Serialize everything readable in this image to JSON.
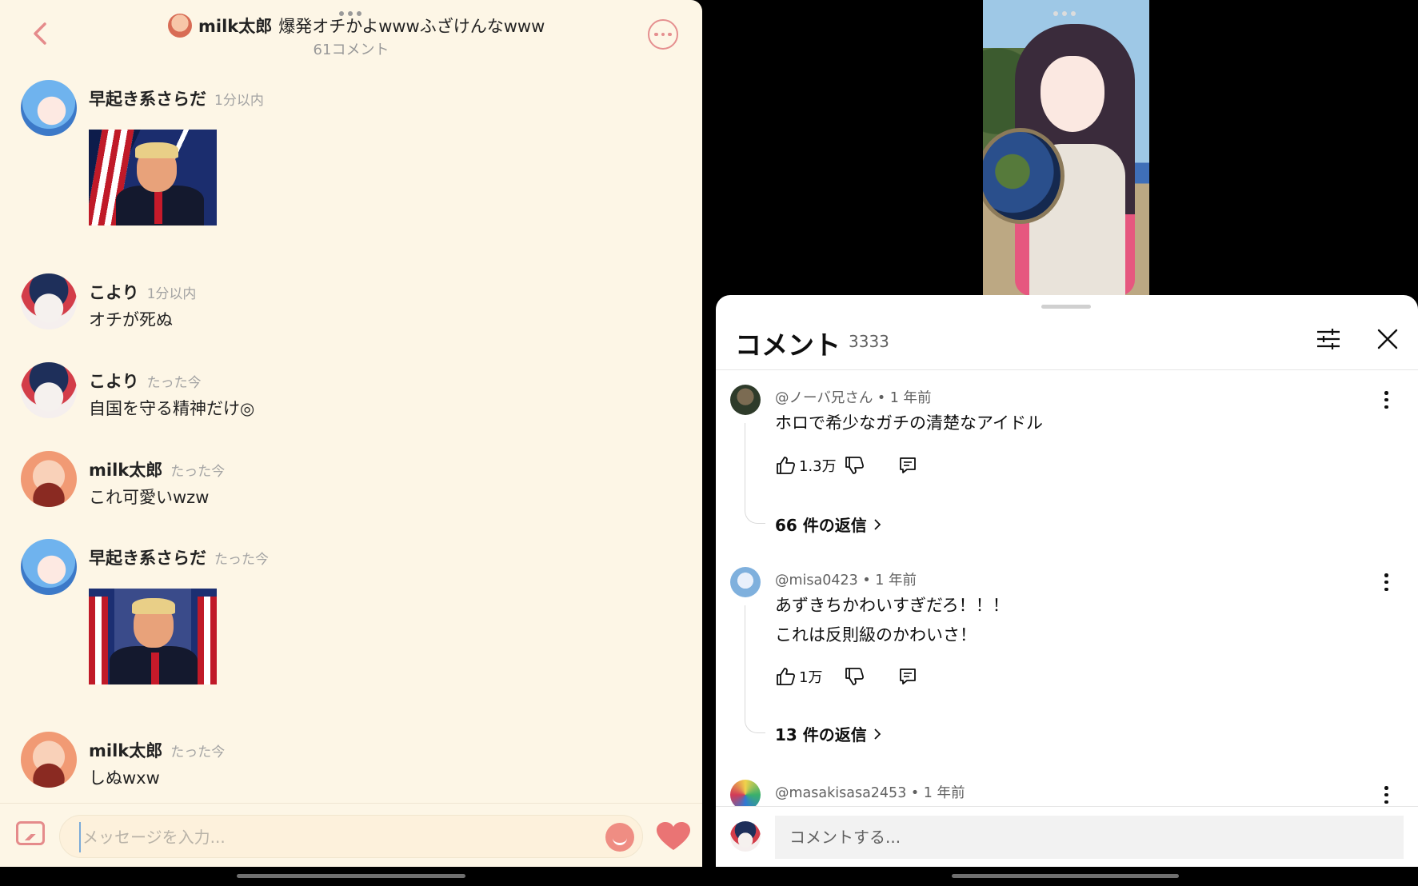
{
  "chat": {
    "header": {
      "author": "milk太郎",
      "title": "爆発オチかよwwwふざけんなwww",
      "comment_count": "61コメント"
    },
    "messages": [
      {
        "user": "早起き系さらだ",
        "time": "1分以内",
        "text": "",
        "image": "photo-trump-flag"
      },
      {
        "user": "こより",
        "time": "1分以内",
        "text": "オチが死ぬ"
      },
      {
        "user": "こより",
        "time": "たった今",
        "text": "自国を守る精神だけ◎"
      },
      {
        "user": "milk太郎",
        "time": "たった今",
        "text": "これ可愛いwzw"
      },
      {
        "user": "早起き系さらだ",
        "time": "たった今",
        "text": "",
        "image": "photo-trump-pointing"
      },
      {
        "user": "milk太郎",
        "time": "たった今",
        "text": "しぬwxw"
      }
    ],
    "composer": {
      "placeholder": "メッセージを入力..."
    },
    "accent": "#e58b8b"
  },
  "youtube": {
    "sheet": {
      "title": "コメント",
      "count": "3333"
    },
    "comments": [
      {
        "author": "@ノーバ兄さん",
        "age": "1 年前",
        "lines": [
          "ホロで希少なガチの清楚なアイドル"
        ],
        "likes": "1.3万",
        "replies": "66 件の返信"
      },
      {
        "author": "@misa0423",
        "age": "1 年前",
        "lines": [
          "あずきちかわいすぎだろ！！！",
          "これは反則級のかわいさ！"
        ],
        "likes": "1万",
        "replies": "13 件の返信"
      },
      {
        "author": "@masakisasa2453",
        "age": "1 年前",
        "lines": []
      }
    ],
    "comment_bar": {
      "placeholder": "コメントする..."
    }
  },
  "icons": [
    "back-chevron-icon",
    "more-icon",
    "gallery-icon",
    "emoji-icon",
    "heart-icon",
    "tune-icon",
    "close-icon",
    "like-icon",
    "dislike-icon",
    "reply-icon",
    "kebab-icon",
    "chevron-right-icon"
  ]
}
